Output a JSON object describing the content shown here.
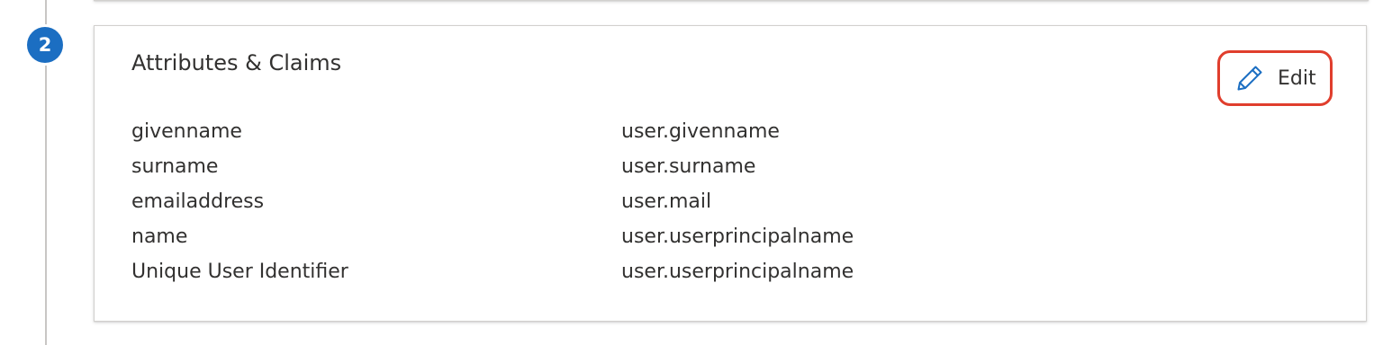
{
  "step": {
    "number": "2"
  },
  "card": {
    "title": "Attributes & Claims",
    "edit_label": "Edit"
  },
  "claims": [
    {
      "name": "givenname",
      "value": "user.givenname"
    },
    {
      "name": "surname",
      "value": "user.surname"
    },
    {
      "name": "emailaddress",
      "value": "user.mail"
    },
    {
      "name": "name",
      "value": "user.userprincipalname"
    },
    {
      "name": "Unique User Identifier",
      "value": "user.userprincipalname"
    }
  ],
  "colors": {
    "step_badge": "#1b6ec2",
    "edit_highlight": "#e03e2d",
    "icon_accent": "#1b6ec2"
  },
  "icons": {
    "edit": "pencil-icon"
  }
}
